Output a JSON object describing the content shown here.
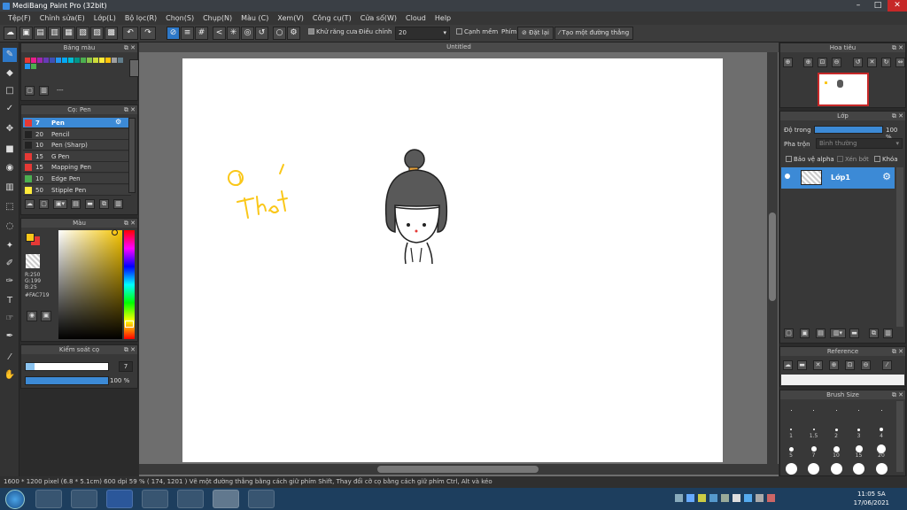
{
  "app": {
    "title": "MediBang Paint Pro (32bit)"
  },
  "window_controls": {
    "minimize": "–",
    "maximize": "□",
    "close": "✕"
  },
  "menu": [
    "Tệp(F)",
    "Chỉnh sửa(E)",
    "Lớp(L)",
    "Bộ lọc(R)",
    "Chọn(S)",
    "Chụp(N)",
    "Màu (C)",
    "Xem(V)",
    "Công cụ(T)",
    "Cửa số(W)",
    "Cloud",
    "Help"
  ],
  "toolbar": {
    "antialias_label": "Khử răng cưa",
    "adjust_label": "Điều chỉnh",
    "adjust_value": "20",
    "soft_edge_label": "Cạnh mềm",
    "key_label": "Phím",
    "reset_label": "Đặt lại",
    "create_line_label": "Tạo một đường thẳng"
  },
  "palette_panel": {
    "title": "Bảng màu",
    "label": "---",
    "colors": [
      "#e53935",
      "#e91e8c",
      "#9c27b0",
      "#673ab7",
      "#3f51b5",
      "#2196f3",
      "#03a9f4",
      "#00bcd4",
      "#009688",
      "#4caf50",
      "#8bc34a",
      "#cddc39",
      "#ffeb3b",
      "#ffc107",
      "#9e9e9e",
      "#607d8b",
      "#2196f3",
      "#4caf50"
    ]
  },
  "brush_panel": {
    "title": "Cọ: Pen",
    "brushes": [
      {
        "size": "7",
        "name": "Pen",
        "color": "#e53935",
        "selected": true
      },
      {
        "size": "20",
        "name": "Pencil",
        "color": "#222222",
        "selected": false
      },
      {
        "size": "10",
        "name": "Pen (Sharp)",
        "color": "#222222",
        "selected": false
      },
      {
        "size": "15",
        "name": "G Pen",
        "color": "#e53935",
        "selected": false
      },
      {
        "size": "15",
        "name": "Mapping Pen",
        "color": "#e53935",
        "selected": false
      },
      {
        "size": "10",
        "name": "Edge Pen",
        "color": "#4caf50",
        "selected": false
      },
      {
        "size": "50",
        "name": "Stipple Pen",
        "color": "#ffeb3b",
        "selected": false
      }
    ]
  },
  "color_panel": {
    "title": "Màu",
    "r": "R:250",
    "g": "G:199",
    "b": "B:25",
    "hex": "#FAC719",
    "fg_color": "#FAC719",
    "bg_color": "#e53935"
  },
  "brush_control": {
    "title": "Kiểm soát cọ",
    "size_value": "7",
    "opacity_value": "100 %",
    "opacity_fraction": 1.0
  },
  "document": {
    "tab_title": "Untitled",
    "drawing_text": "@ Thật"
  },
  "navigator": {
    "title": "Hoa tiêu"
  },
  "layer_panel": {
    "title": "Lớp",
    "opacity_label": "Độ trong",
    "opacity_value": "100 %",
    "opacity_fraction": 1.0,
    "blend_label": "Pha trộn",
    "blend_value": "Bình thường",
    "protect_alpha": "Bảo vệ alpha",
    "clipping": "Xén bớt",
    "lock": "Khóa",
    "layer_name": "Lớp1"
  },
  "reference_panel": {
    "title": "Reference"
  },
  "brush_size_panel": {
    "title": "Brush Size",
    "rows": [
      [
        ".",
        ".",
        ".",
        ".",
        "."
      ],
      [
        "1",
        "1.5",
        "2",
        "3",
        "4"
      ],
      [
        "5",
        "7",
        "10",
        "15",
        "20"
      ]
    ]
  },
  "status": {
    "text": "1600 * 1200 pixel   (6.8 * 5.1cm)   600 dpi   59 %   ( 174, 1201 )   Vẽ một đường thẳng bằng cách giữ phím Shift, Thay đổi cỡ cọ bằng cách giữ phím Ctrl, Alt và kéo"
  },
  "clock": {
    "time": "11:05 SA",
    "date": "17/06/2021"
  },
  "colors": {
    "accent": "#3c8ad6",
    "ink": "#FAC719"
  }
}
